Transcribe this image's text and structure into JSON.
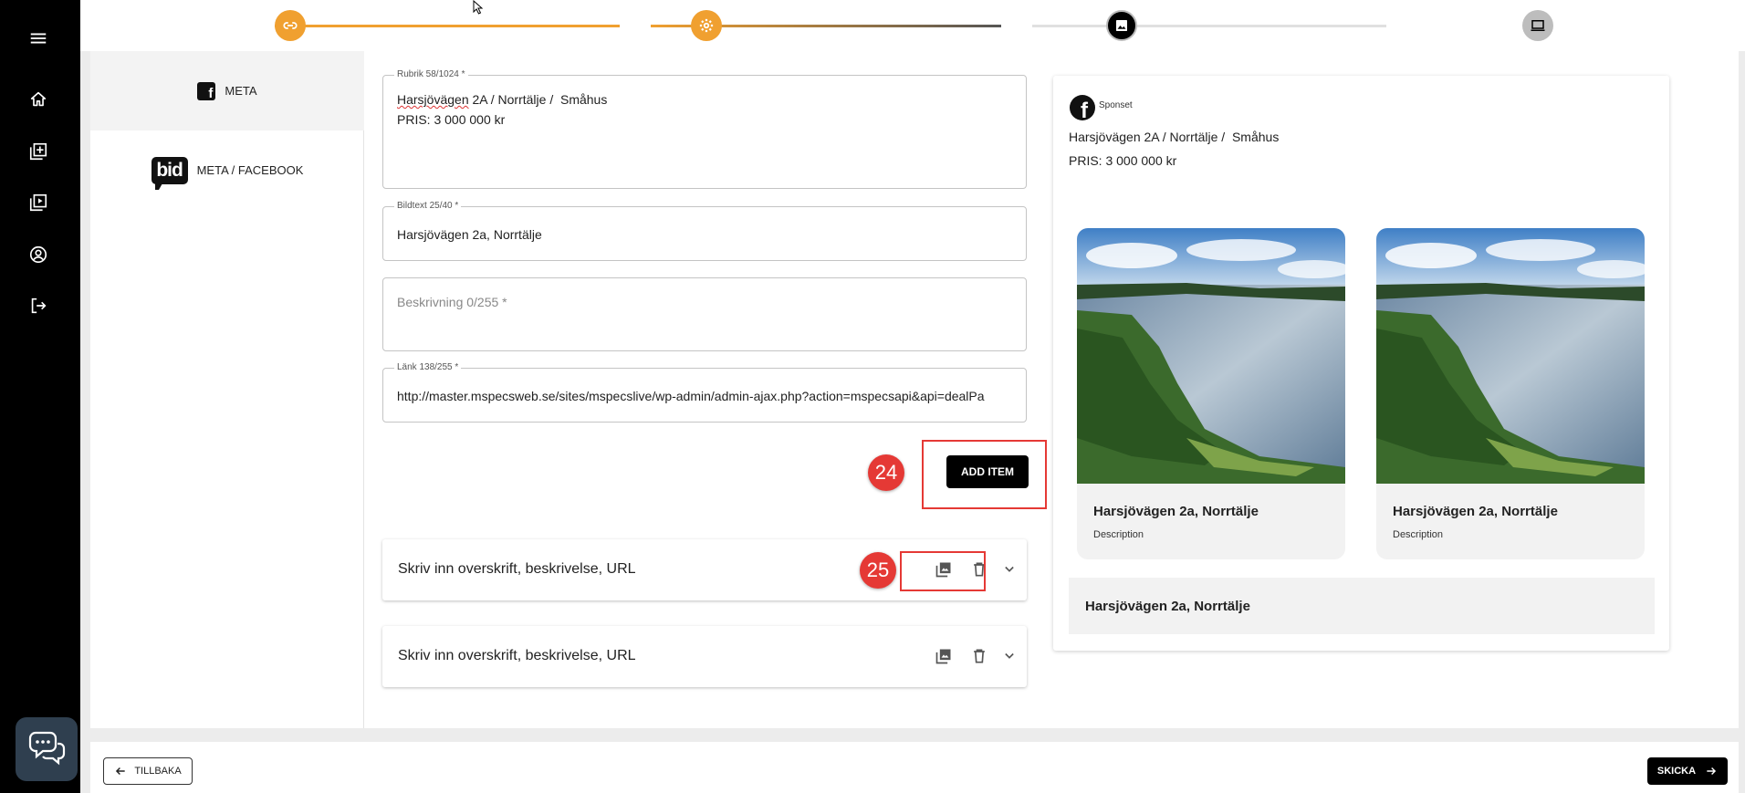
{
  "nav": {
    "icons": [
      "menu-icon",
      "home-icon",
      "add-library-icon",
      "video-library-icon",
      "account-circle-icon",
      "logout-icon"
    ]
  },
  "stepper": {
    "steps": [
      "link-icon",
      "settings-icon",
      "image-icon",
      "computer-icon"
    ],
    "colors": {
      "done": "#f0a030",
      "active": "#000000",
      "pending": "#bdbdbd"
    }
  },
  "sidebar": {
    "tabs": [
      {
        "label": "META"
      },
      {
        "label": "META / FACEBOOK"
      }
    ],
    "bid_logo_text": "bid"
  },
  "form": {
    "rubrik": {
      "label": "Rubrik 58/1024 *",
      "line1_underlined": "Harsjövägen",
      "line1_rest": " 2A / Norrtälje /  Småhus",
      "line2": "PRIS: 3 000 000 kr"
    },
    "bildtext": {
      "label": "Bildtext 25/40 *",
      "value": "Harsjövägen 2a, Norrtälje"
    },
    "beskrivning": {
      "placeholder": "Beskrivning 0/255 *"
    },
    "lank": {
      "label": "Länk 138/255 *",
      "value": "http://master.mspecsweb.se/sites/mspecslive/wp-admin/admin-ajax.php?action=mspecsapi&api=dealPa"
    },
    "add_item_label": "ADD ITEM",
    "items": [
      {
        "label": "Skriv inn overskrift, beskrivelse, URL"
      },
      {
        "label": "Skriv inn overskrift, beskrivelse, URL"
      }
    ]
  },
  "annotations": {
    "badge_24": "24",
    "badge_25": "25"
  },
  "preview": {
    "sponsored": "Sponset",
    "headline_line1": "Harsjövägen 2A / Norrtälje /  Småhus",
    "headline_line2": "PRIS: 3 000 000 kr",
    "cards": [
      {
        "title": "Harsjövägen 2a, Norrtälje",
        "desc": "Description"
      },
      {
        "title": "Harsjövägen 2a, Norrtälje",
        "desc": "Description"
      }
    ],
    "bottom_title": "Harsjövägen 2a, Norrtälje"
  },
  "footer": {
    "back_label": "TILLBAKA",
    "send_label": "SKICKA"
  }
}
